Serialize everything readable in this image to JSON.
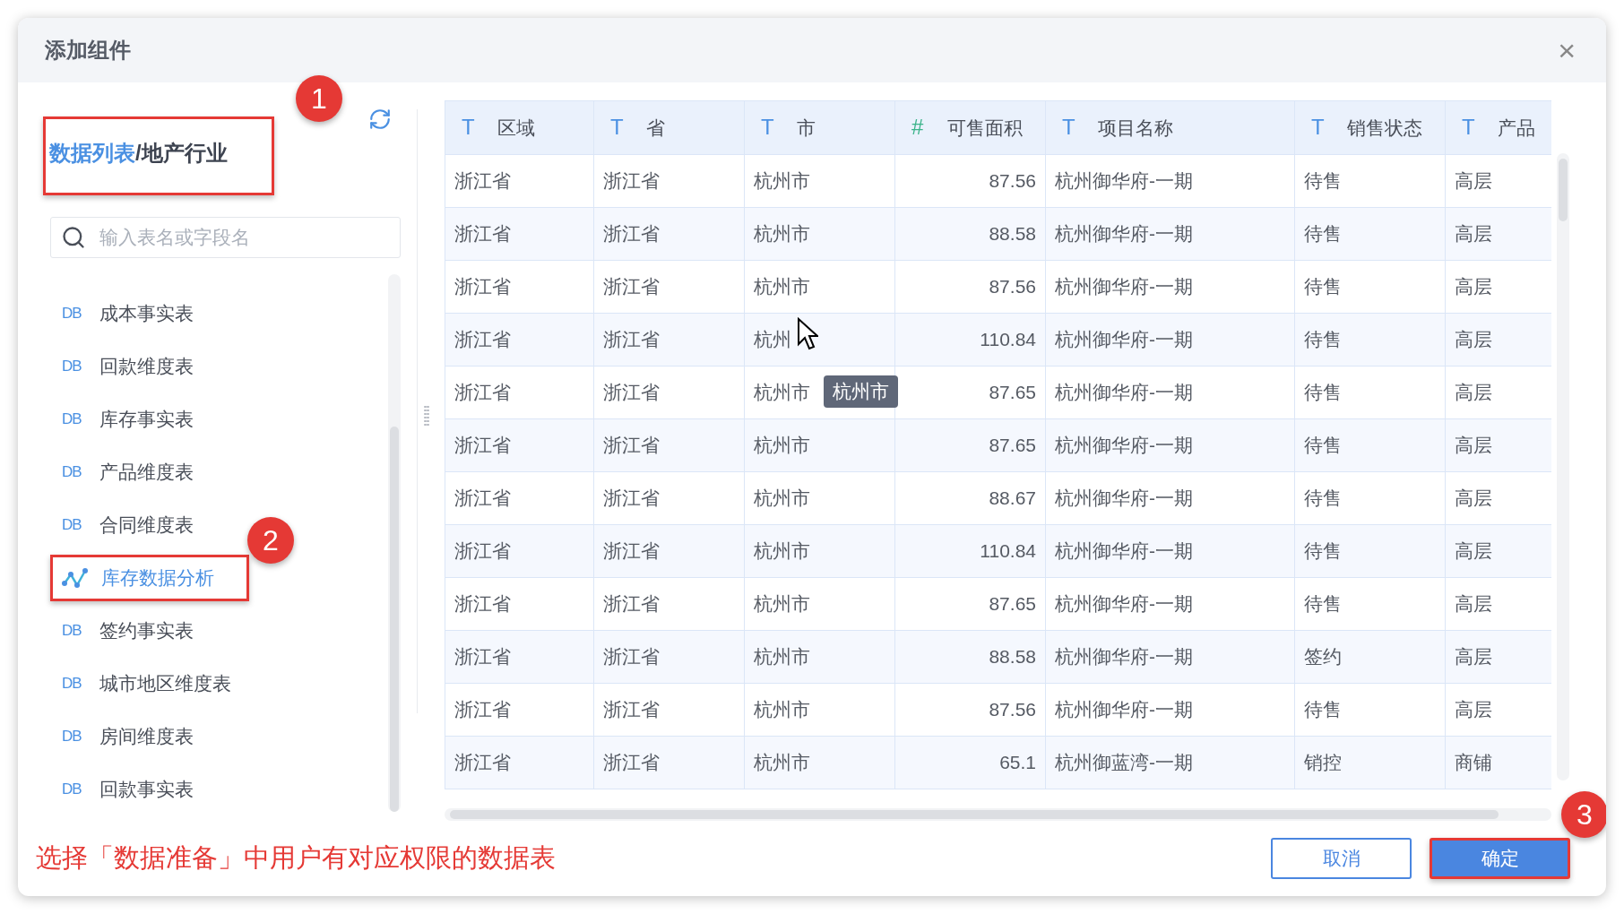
{
  "window": {
    "title": "添加组件",
    "close": "×"
  },
  "breadcrumb": {
    "link": "数据列表",
    "separator": "/",
    "current": "地产行业",
    "marker": "1"
  },
  "search": {
    "placeholder": "输入表名或字段名"
  },
  "sidebar": {
    "items": [
      {
        "kind": "table",
        "icon": "DB",
        "label": "成本事实表",
        "selected": false
      },
      {
        "kind": "table",
        "icon": "DB",
        "label": "回款维度表",
        "selected": false
      },
      {
        "kind": "table",
        "icon": "DB",
        "label": "库存事实表",
        "selected": false
      },
      {
        "kind": "table",
        "icon": "DB",
        "label": "产品维度表",
        "selected": false
      },
      {
        "kind": "table",
        "icon": "DB",
        "label": "合同维度表",
        "selected": false
      },
      {
        "kind": "analysis",
        "label": "库存数据分析",
        "selected": true,
        "marker": "2"
      },
      {
        "kind": "table",
        "icon": "DB",
        "label": "签约事实表",
        "selected": false
      },
      {
        "kind": "table",
        "icon": "DB",
        "label": "城市地区维度表",
        "selected": false
      },
      {
        "kind": "table",
        "icon": "DB",
        "label": "房间维度表",
        "selected": false
      },
      {
        "kind": "table",
        "icon": "DB",
        "label": "回款事实表",
        "selected": false
      }
    ]
  },
  "table": {
    "columns": [
      {
        "kind": "text",
        "icon": "T",
        "label": "区域"
      },
      {
        "kind": "text",
        "icon": "T",
        "label": "省"
      },
      {
        "kind": "text",
        "icon": "T",
        "label": "市"
      },
      {
        "kind": "number",
        "icon": "#",
        "label": "可售面积"
      },
      {
        "kind": "text",
        "icon": "T",
        "label": "项目名称"
      },
      {
        "kind": "text",
        "icon": "T",
        "label": "销售状态"
      },
      {
        "kind": "text",
        "icon": "T",
        "label": "产品"
      }
    ],
    "rows": [
      {
        "cells": [
          "浙江省",
          "浙江省",
          "杭州市",
          "87.56",
          "杭州御华府-一期",
          "待售",
          "高层"
        ]
      },
      {
        "cells": [
          "浙江省",
          "浙江省",
          "杭州市",
          "88.58",
          "杭州御华府-一期",
          "待售",
          "高层"
        ]
      },
      {
        "cells": [
          "浙江省",
          "浙江省",
          "杭州市",
          "87.56",
          "杭州御华府-一期",
          "待售",
          "高层"
        ]
      },
      {
        "cells": [
          "浙江省",
          "浙江省",
          "杭州",
          "110.84",
          "杭州御华府-一期",
          "待售",
          "高层"
        ],
        "cursor": true
      },
      {
        "cells": [
          "浙江省",
          "浙江省",
          "杭州市",
          "87.65",
          "杭州御华府-一期",
          "待售",
          "高层"
        ],
        "tooltip": "杭州市"
      },
      {
        "cells": [
          "浙江省",
          "浙江省",
          "杭州市",
          "87.65",
          "杭州御华府-一期",
          "待售",
          "高层"
        ]
      },
      {
        "cells": [
          "浙江省",
          "浙江省",
          "杭州市",
          "88.67",
          "杭州御华府-一期",
          "待售",
          "高层"
        ]
      },
      {
        "cells": [
          "浙江省",
          "浙江省",
          "杭州市",
          "110.84",
          "杭州御华府-一期",
          "待售",
          "高层"
        ]
      },
      {
        "cells": [
          "浙江省",
          "浙江省",
          "杭州市",
          "87.65",
          "杭州御华府-一期",
          "待售",
          "高层"
        ]
      },
      {
        "cells": [
          "浙江省",
          "浙江省",
          "杭州市",
          "88.58",
          "杭州御华府-一期",
          "签约",
          "高层"
        ]
      },
      {
        "cells": [
          "浙江省",
          "浙江省",
          "杭州市",
          "87.56",
          "杭州御华府-一期",
          "待售",
          "高层"
        ]
      },
      {
        "cells": [
          "浙江省",
          "浙江省",
          "杭州市",
          "65.1",
          "杭州御蓝湾-一期",
          "销控",
          "商铺"
        ]
      }
    ]
  },
  "hint": "选择「数据准备」中用户有对应权限的数据表",
  "buttons": [
    {
      "kind": "secondary",
      "label": "取消"
    },
    {
      "kind": "primary",
      "label": "确定",
      "marker": "3"
    }
  ]
}
